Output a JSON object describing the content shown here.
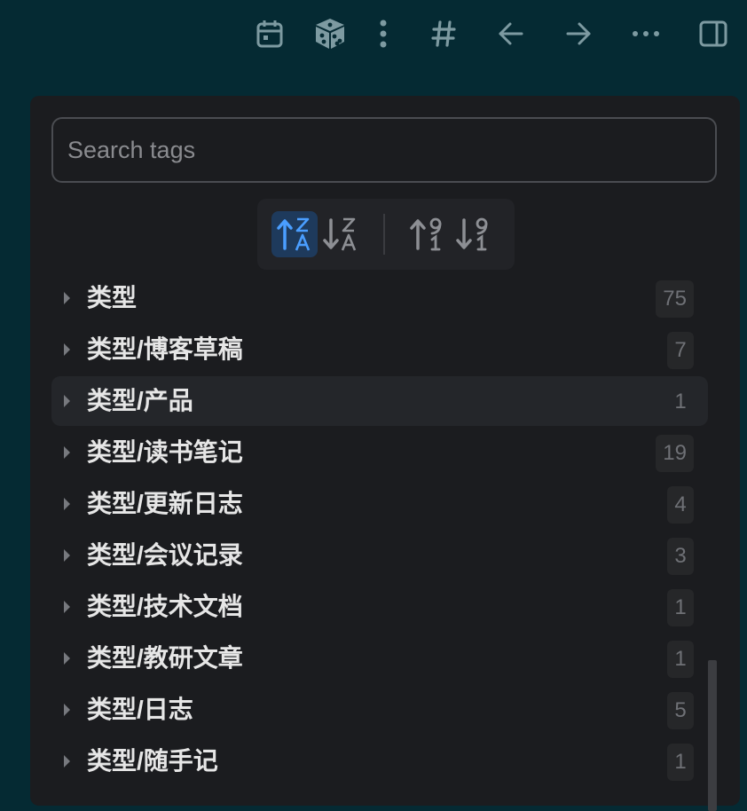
{
  "toolbar": {
    "icons": [
      "calendar-icon",
      "dice-icon",
      "more-vertical-icon",
      "hash-icon",
      "arrow-left-icon",
      "arrow-right-icon",
      "more-horizontal-icon",
      "sidebar-toggle-icon"
    ]
  },
  "search": {
    "placeholder": "Search tags",
    "value": ""
  },
  "sort": {
    "active": "alpha-asc"
  },
  "tags": [
    {
      "label": "类型",
      "count": "75"
    },
    {
      "label": "类型/博客草稿",
      "count": "7"
    },
    {
      "label": "类型/产品",
      "count": "1"
    },
    {
      "label": "类型/读书笔记",
      "count": "19"
    },
    {
      "label": "类型/更新日志",
      "count": "4"
    },
    {
      "label": "类型/会议记录",
      "count": "3"
    },
    {
      "label": "类型/技术文档",
      "count": "1"
    },
    {
      "label": "类型/教研文章",
      "count": "1"
    },
    {
      "label": "类型/日志",
      "count": "5"
    },
    {
      "label": "类型/随手记",
      "count": "1"
    }
  ],
  "colors": {
    "background": "#052a33",
    "panel": "#1b1c1f",
    "accent": "#4a9eff",
    "icon": "#7d9aa1"
  }
}
